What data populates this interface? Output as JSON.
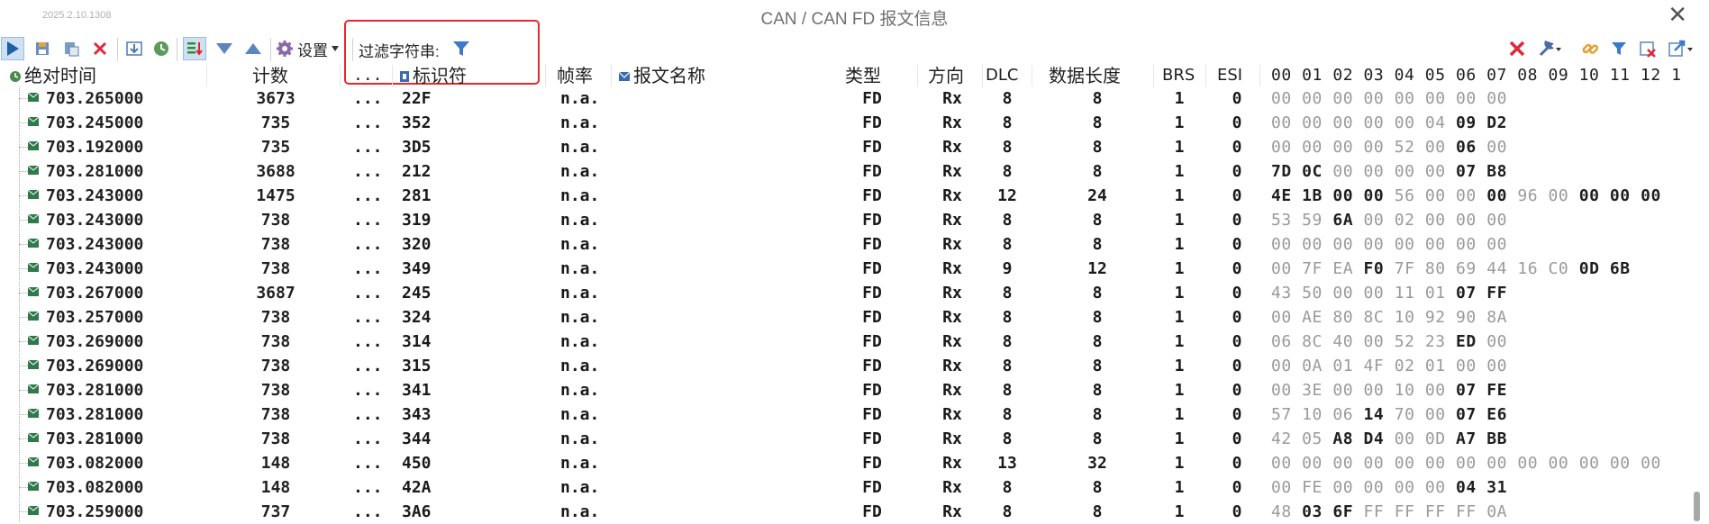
{
  "window": {
    "version": "2025.2.10.1308",
    "title": "CAN / CAN FD 报文信息"
  },
  "toolbar": {
    "settings_label": "设置",
    "filter_label": "过滤字符串:",
    "filter_value": ""
  },
  "columns": {
    "time": "绝对时间",
    "count": "计数",
    "dots": "...",
    "id": "标识符",
    "rate": "帧率",
    "name": "报文名称",
    "type": "类型",
    "direction": "方向",
    "dlc": "DLC",
    "datalen": "数据长度",
    "brs": "BRS",
    "esi": "ESI",
    "bytes": [
      "00",
      "01",
      "02",
      "03",
      "04",
      "05",
      "06",
      "07",
      "08",
      "09",
      "10",
      "11",
      "12",
      "1"
    ]
  },
  "rows": [
    {
      "time": "703.265000",
      "count": "3673",
      "dots": "...",
      "id": "22F",
      "rate": "n.a.",
      "type": "FD",
      "dir": "Rx",
      "dlc": "8",
      "len": "8",
      "brs": "1",
      "esi": "0",
      "bytes": [
        [
          "00",
          0
        ],
        [
          "00",
          0
        ],
        [
          "00",
          0
        ],
        [
          "00",
          0
        ],
        [
          "00",
          0
        ],
        [
          "00",
          0
        ],
        [
          "00",
          0
        ],
        [
          "00",
          0
        ]
      ]
    },
    {
      "time": "703.245000",
      "count": "735",
      "dots": "...",
      "id": "352",
      "rate": "n.a.",
      "type": "FD",
      "dir": "Rx",
      "dlc": "8",
      "len": "8",
      "brs": "1",
      "esi": "0",
      "bytes": [
        [
          "00",
          0
        ],
        [
          "00",
          0
        ],
        [
          "00",
          0
        ],
        [
          "00",
          0
        ],
        [
          "00",
          0
        ],
        [
          "04",
          0
        ],
        [
          "09",
          1
        ],
        [
          "D2",
          1
        ]
      ]
    },
    {
      "time": "703.192000",
      "count": "735",
      "dots": "...",
      "id": "3D5",
      "rate": "n.a.",
      "type": "FD",
      "dir": "Rx",
      "dlc": "8",
      "len": "8",
      "brs": "1",
      "esi": "0",
      "bytes": [
        [
          "00",
          0
        ],
        [
          "00",
          0
        ],
        [
          "00",
          0
        ],
        [
          "00",
          0
        ],
        [
          "52",
          0
        ],
        [
          "00",
          0
        ],
        [
          "06",
          1
        ],
        [
          "00",
          0
        ]
      ]
    },
    {
      "time": "703.281000",
      "count": "3688",
      "dots": "...",
      "id": "212",
      "rate": "n.a.",
      "type": "FD",
      "dir": "Rx",
      "dlc": "8",
      "len": "8",
      "brs": "1",
      "esi": "0",
      "bytes": [
        [
          "7D",
          1
        ],
        [
          "0C",
          1
        ],
        [
          "00",
          0
        ],
        [
          "00",
          0
        ],
        [
          "00",
          0
        ],
        [
          "00",
          0
        ],
        [
          "07",
          1
        ],
        [
          "B8",
          1
        ]
      ]
    },
    {
      "time": "703.243000",
      "count": "1475",
      "dots": "...",
      "id": "281",
      "rate": "n.a.",
      "type": "FD",
      "dir": "Rx",
      "dlc": "12",
      "len": "24",
      "brs": "1",
      "esi": "0",
      "bytes": [
        [
          "4E",
          1
        ],
        [
          "1B",
          1
        ],
        [
          "00",
          1
        ],
        [
          "00",
          1
        ],
        [
          "56",
          0
        ],
        [
          "00",
          0
        ],
        [
          "00",
          0
        ],
        [
          "00",
          1
        ],
        [
          "96",
          0
        ],
        [
          "00",
          0
        ],
        [
          "00",
          1
        ],
        [
          "00",
          1
        ],
        [
          "00",
          1
        ]
      ]
    },
    {
      "time": "703.243000",
      "count": "738",
      "dots": "...",
      "id": "319",
      "rate": "n.a.",
      "type": "FD",
      "dir": "Rx",
      "dlc": "8",
      "len": "8",
      "brs": "1",
      "esi": "0",
      "bytes": [
        [
          "53",
          0
        ],
        [
          "59",
          0
        ],
        [
          "6A",
          1
        ],
        [
          "00",
          0
        ],
        [
          "02",
          0
        ],
        [
          "00",
          0
        ],
        [
          "00",
          0
        ],
        [
          "00",
          0
        ]
      ]
    },
    {
      "time": "703.243000",
      "count": "738",
      "dots": "...",
      "id": "320",
      "rate": "n.a.",
      "type": "FD",
      "dir": "Rx",
      "dlc": "8",
      "len": "8",
      "brs": "1",
      "esi": "0",
      "bytes": [
        [
          "00",
          0
        ],
        [
          "00",
          0
        ],
        [
          "00",
          0
        ],
        [
          "00",
          0
        ],
        [
          "00",
          0
        ],
        [
          "00",
          0
        ],
        [
          "00",
          0
        ],
        [
          "00",
          0
        ]
      ]
    },
    {
      "time": "703.243000",
      "count": "738",
      "dots": "...",
      "id": "349",
      "rate": "n.a.",
      "type": "FD",
      "dir": "Rx",
      "dlc": "9",
      "len": "12",
      "brs": "1",
      "esi": "0",
      "bytes": [
        [
          "00",
          0
        ],
        [
          "7F",
          0
        ],
        [
          "EA",
          0
        ],
        [
          "F0",
          1
        ],
        [
          "7F",
          0
        ],
        [
          "80",
          0
        ],
        [
          "69",
          0
        ],
        [
          "44",
          0
        ],
        [
          "16",
          0
        ],
        [
          "C0",
          0
        ],
        [
          "0D",
          1
        ],
        [
          "6B",
          1
        ]
      ]
    },
    {
      "time": "703.267000",
      "count": "3687",
      "dots": "...",
      "id": "245",
      "rate": "n.a.",
      "type": "FD",
      "dir": "Rx",
      "dlc": "8",
      "len": "8",
      "brs": "1",
      "esi": "0",
      "bytes": [
        [
          "43",
          0
        ],
        [
          "50",
          0
        ],
        [
          "00",
          0
        ],
        [
          "00",
          0
        ],
        [
          "11",
          0
        ],
        [
          "01",
          0
        ],
        [
          "07",
          1
        ],
        [
          "FF",
          1
        ]
      ]
    },
    {
      "time": "703.257000",
      "count": "738",
      "dots": "...",
      "id": "324",
      "rate": "n.a.",
      "type": "FD",
      "dir": "Rx",
      "dlc": "8",
      "len": "8",
      "brs": "1",
      "esi": "0",
      "bytes": [
        [
          "00",
          0
        ],
        [
          "AE",
          0
        ],
        [
          "80",
          0
        ],
        [
          "8C",
          0
        ],
        [
          "10",
          0
        ],
        [
          "92",
          0
        ],
        [
          "90",
          0
        ],
        [
          "8A",
          0
        ]
      ]
    },
    {
      "time": "703.269000",
      "count": "738",
      "dots": "...",
      "id": "314",
      "rate": "n.a.",
      "type": "FD",
      "dir": "Rx",
      "dlc": "8",
      "len": "8",
      "brs": "1",
      "esi": "0",
      "bytes": [
        [
          "06",
          0
        ],
        [
          "8C",
          0
        ],
        [
          "40",
          0
        ],
        [
          "00",
          0
        ],
        [
          "52",
          0
        ],
        [
          "23",
          0
        ],
        [
          "ED",
          1
        ],
        [
          "00",
          0
        ]
      ]
    },
    {
      "time": "703.269000",
      "count": "738",
      "dots": "...",
      "id": "315",
      "rate": "n.a.",
      "type": "FD",
      "dir": "Rx",
      "dlc": "8",
      "len": "8",
      "brs": "1",
      "esi": "0",
      "bytes": [
        [
          "00",
          0
        ],
        [
          "0A",
          0
        ],
        [
          "01",
          0
        ],
        [
          "4F",
          0
        ],
        [
          "02",
          0
        ],
        [
          "01",
          0
        ],
        [
          "00",
          0
        ],
        [
          "00",
          0
        ]
      ]
    },
    {
      "time": "703.281000",
      "count": "738",
      "dots": "...",
      "id": "341",
      "rate": "n.a.",
      "type": "FD",
      "dir": "Rx",
      "dlc": "8",
      "len": "8",
      "brs": "1",
      "esi": "0",
      "bytes": [
        [
          "00",
          0
        ],
        [
          "3E",
          0
        ],
        [
          "00",
          0
        ],
        [
          "00",
          0
        ],
        [
          "10",
          0
        ],
        [
          "00",
          0
        ],
        [
          "07",
          1
        ],
        [
          "FE",
          1
        ]
      ]
    },
    {
      "time": "703.281000",
      "count": "738",
      "dots": "...",
      "id": "343",
      "rate": "n.a.",
      "type": "FD",
      "dir": "Rx",
      "dlc": "8",
      "len": "8",
      "brs": "1",
      "esi": "0",
      "bytes": [
        [
          "57",
          0
        ],
        [
          "10",
          0
        ],
        [
          "06",
          0
        ],
        [
          "14",
          1
        ],
        [
          "70",
          0
        ],
        [
          "00",
          0
        ],
        [
          "07",
          1
        ],
        [
          "E6",
          1
        ]
      ]
    },
    {
      "time": "703.281000",
      "count": "738",
      "dots": "...",
      "id": "344",
      "rate": "n.a.",
      "type": "FD",
      "dir": "Rx",
      "dlc": "8",
      "len": "8",
      "brs": "1",
      "esi": "0",
      "bytes": [
        [
          "42",
          0
        ],
        [
          "05",
          0
        ],
        [
          "A8",
          1
        ],
        [
          "D4",
          1
        ],
        [
          "00",
          0
        ],
        [
          "0D",
          0
        ],
        [
          "A7",
          1
        ],
        [
          "BB",
          1
        ]
      ]
    },
    {
      "time": "703.082000",
      "count": "148",
      "dots": "...",
      "id": "450",
      "rate": "n.a.",
      "type": "FD",
      "dir": "Rx",
      "dlc": "13",
      "len": "32",
      "brs": "1",
      "esi": "0",
      "bytes": [
        [
          "00",
          0
        ],
        [
          "00",
          0
        ],
        [
          "00",
          0
        ],
        [
          "00",
          0
        ],
        [
          "00",
          0
        ],
        [
          "00",
          0
        ],
        [
          "00",
          0
        ],
        [
          "00",
          0
        ],
        [
          "00",
          0
        ],
        [
          "00",
          0
        ],
        [
          "00",
          0
        ],
        [
          "00",
          0
        ],
        [
          "00",
          0
        ]
      ]
    },
    {
      "time": "703.082000",
      "count": "148",
      "dots": "...",
      "id": "42A",
      "rate": "n.a.",
      "type": "FD",
      "dir": "Rx",
      "dlc": "8",
      "len": "8",
      "brs": "1",
      "esi": "0",
      "bytes": [
        [
          "00",
          0
        ],
        [
          "FE",
          0
        ],
        [
          "00",
          0
        ],
        [
          "00",
          0
        ],
        [
          "00",
          0
        ],
        [
          "00",
          0
        ],
        [
          "04",
          1
        ],
        [
          "31",
          1
        ]
      ]
    },
    {
      "time": "703.259000",
      "count": "737",
      "dots": "...",
      "id": "3A6",
      "rate": "n.a.",
      "type": "FD",
      "dir": "Rx",
      "dlc": "8",
      "len": "8",
      "brs": "1",
      "esi": "0",
      "bytes": [
        [
          "48",
          0
        ],
        [
          "03",
          1
        ],
        [
          "6F",
          1
        ],
        [
          "FF",
          0
        ],
        [
          "FF",
          0
        ],
        [
          "FF",
          0
        ],
        [
          "FF",
          0
        ],
        [
          "0A",
          0
        ]
      ]
    }
  ]
}
